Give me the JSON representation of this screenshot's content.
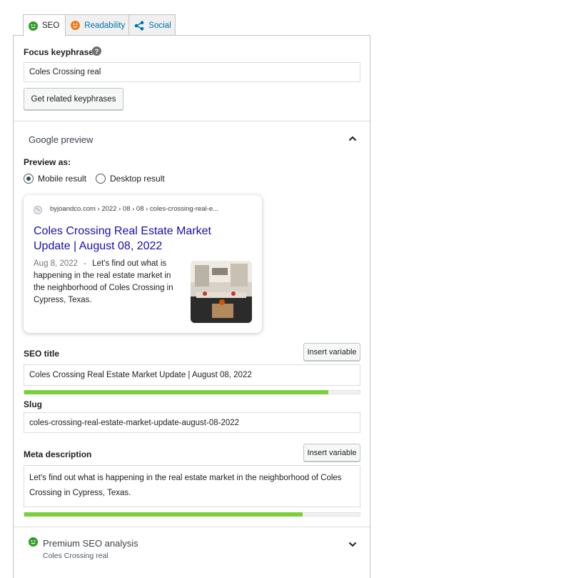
{
  "tabs": [
    {
      "label": "SEO",
      "icon": "smiley-green-icon",
      "active": true
    },
    {
      "label": "Readability",
      "icon": "smiley-orange-icon",
      "active": false
    },
    {
      "label": "Social",
      "icon": "share-icon",
      "active": false
    }
  ],
  "focus": {
    "label": "Focus keyphrase",
    "value": "Coles Crossing real",
    "related_button": "Get related keyphrases"
  },
  "google_preview": {
    "heading": "Google preview",
    "preview_as_label": "Preview as:",
    "options": [
      "Mobile result",
      "Desktop result"
    ],
    "selected": "Mobile result",
    "snippet": {
      "breadcrumb": "byjoandco.com › 2022 › 08 › 08 › coles-crossing-real-e...",
      "title": "Coles Crossing Real Estate Market Update | August 08, 2022",
      "date": "Aug 8, 2022",
      "separator": "-",
      "description": "Let's find out what is happening in the real estate market in the neighborhood of Coles Crossing in Cypress, Texas."
    }
  },
  "seo_title": {
    "label": "SEO title",
    "insert_button": "Insert variable",
    "value": "Coles Crossing Real Estate Market Update | August 08, 2022",
    "progress": 0.906
  },
  "slug": {
    "label": "Slug",
    "value": "coles-crossing-real-estate-market-update-august-08-2022"
  },
  "meta_description": {
    "label": "Meta description",
    "insert_button": "Insert variable",
    "value": "Let's find out what is happening in the real estate market in the neighborhood of Coles Crossing in Cypress, Texas.",
    "progress": 0.829
  },
  "premium": {
    "heading": "Premium SEO analysis",
    "subtitle": "Coles Crossing real"
  },
  "colors": {
    "good": "#7ad03a",
    "ok": "#ee7c1b",
    "link": "#0073aa",
    "snippet_title": "#1a0dab"
  }
}
